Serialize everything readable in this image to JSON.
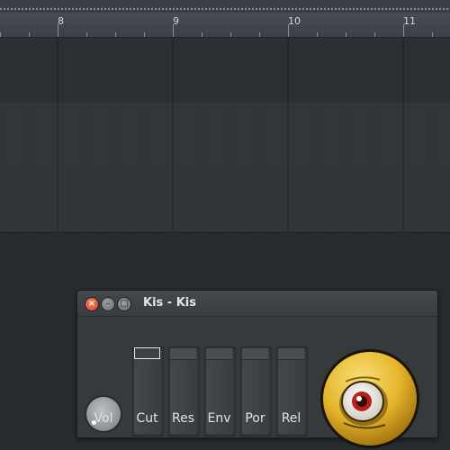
{
  "timeline": {
    "bars": [
      "8",
      "9",
      "10",
      "11"
    ]
  },
  "plugin": {
    "title": "Kis - Kis",
    "close_glyph": "×",
    "minimize_glyph": "–",
    "maximize_glyph": "□",
    "knob": {
      "label": "Vol"
    },
    "sliders": [
      {
        "label": "Cut"
      },
      {
        "label": "Res"
      },
      {
        "label": "Env"
      },
      {
        "label": "Por"
      },
      {
        "label": "Rel"
      }
    ]
  },
  "colors": {
    "accent_close": "#d84a2b",
    "mascot_yellow": "#e6b62c"
  }
}
